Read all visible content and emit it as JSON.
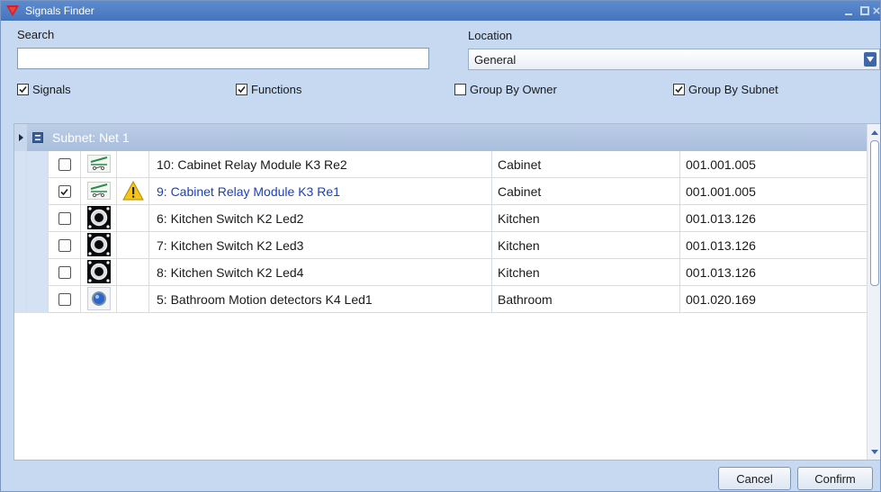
{
  "window": {
    "title": "Signals Finder",
    "accent": "#4574bb",
    "logo_color": "#d0202a"
  },
  "search": {
    "label": "Search",
    "value": "",
    "placeholder": ""
  },
  "location": {
    "label": "Location",
    "selected": "General"
  },
  "options": {
    "signals": {
      "label": "Signals",
      "checked": true
    },
    "functions": {
      "label": "Functions",
      "checked": true
    },
    "group_by_owner": {
      "label": "Group By Owner",
      "checked": false
    },
    "group_by_subnet": {
      "label": "Group By Subnet",
      "checked": true
    }
  },
  "grid": {
    "group_label": "Subnet: Net 1",
    "rows": [
      {
        "checked": false,
        "icon": "relay-icon",
        "warning": false,
        "name": "10: Cabinet Relay Module K3 Re2",
        "location": "Cabinet",
        "address": "001.001.005"
      },
      {
        "checked": true,
        "icon": "relay-icon",
        "warning": true,
        "name": "9: Cabinet Relay Module K3 Re1",
        "location": "Cabinet",
        "address": "001.001.005"
      },
      {
        "checked": false,
        "icon": "switch-icon",
        "warning": false,
        "name": "6: Kitchen Switch K2 Led2",
        "location": "Kitchen",
        "address": "001.013.126"
      },
      {
        "checked": false,
        "icon": "switch-icon",
        "warning": false,
        "name": "7: Kitchen Switch K2 Led3",
        "location": "Kitchen",
        "address": "001.013.126"
      },
      {
        "checked": false,
        "icon": "switch-icon",
        "warning": false,
        "name": "8: Kitchen Switch K2 Led4",
        "location": "Kitchen",
        "address": "001.013.126"
      },
      {
        "checked": false,
        "icon": "motion-detector-icon",
        "warning": false,
        "name": "5: Bathroom Motion detectors K4 Led1",
        "location": "Bathroom",
        "address": "001.020.169"
      }
    ]
  },
  "footer": {
    "cancel_label": "Cancel",
    "confirm_label": "Confirm"
  }
}
